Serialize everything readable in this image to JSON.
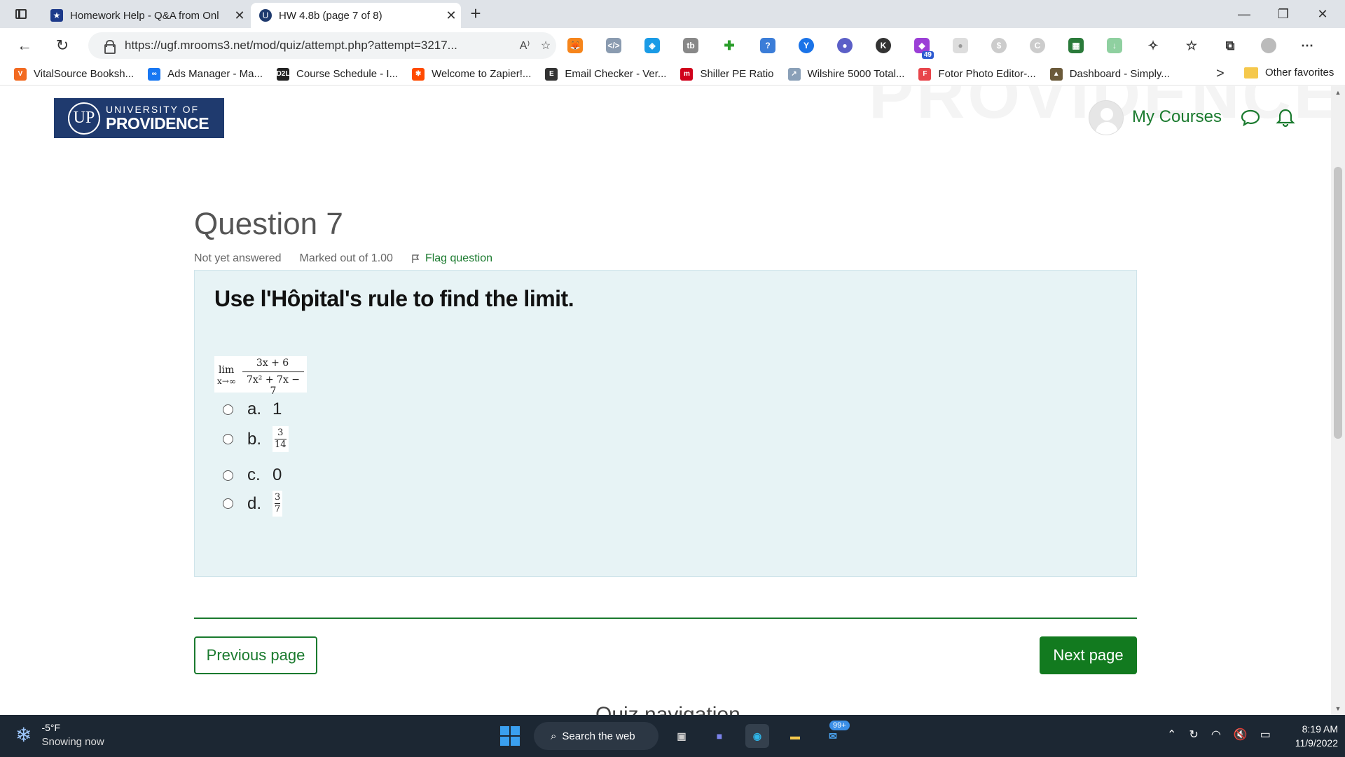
{
  "browser": {
    "tabs": [
      {
        "title": "Homework Help - Q&A from Onl",
        "favicon": "star-icon",
        "active": false
      },
      {
        "title": "HW 4.8b (page 7 of 8)",
        "favicon": "providence-icon",
        "active": true
      }
    ],
    "new_tab_glyph": "+",
    "url": "https://ugf.mrooms3.net/mod/quiz/attempt.php?attempt=3217...",
    "read_aloud_glyph": "A⁾",
    "extensions_badge": "49",
    "bookmarks": [
      {
        "label": "VitalSource Booksh...",
        "icon": "vitalsource-icon",
        "color": "#f26a21",
        "glyph": "V"
      },
      {
        "label": "Ads Manager - Ma...",
        "icon": "meta-icon",
        "color": "#1877f2",
        "glyph": "∞"
      },
      {
        "label": "Course Schedule - I...",
        "icon": "d2l-icon",
        "color": "#222222",
        "glyph": "D2L"
      },
      {
        "label": "Welcome to Zapier!...",
        "icon": "zapier-icon",
        "color": "#ff4a00",
        "glyph": "✱"
      },
      {
        "label": "Email Checker - Ver...",
        "icon": "email-checker-icon",
        "color": "#333333",
        "glyph": "E"
      },
      {
        "label": "Shiller PE Ratio",
        "icon": "multpl-icon",
        "color": "#d0021b",
        "glyph": "m"
      },
      {
        "label": "Wilshire 5000 Total...",
        "icon": "chart-icon",
        "color": "#8aa0b8",
        "glyph": "↗"
      },
      {
        "label": "Fotor Photo Editor-...",
        "icon": "fotor-icon",
        "color": "#e8454b",
        "glyph": "F"
      },
      {
        "label": "Dashboard - Simply...",
        "icon": "owl-icon",
        "color": "#6b5a3a",
        "glyph": "▲"
      }
    ],
    "more_glyph": ">",
    "other_favorites": "Other favorites"
  },
  "site": {
    "logo_line1": "UNIVERSITY OF",
    "logo_line2": "PROVIDENCE",
    "logo_seal": "UP",
    "watermark": "PROVIDENCE",
    "my_courses": "My Courses"
  },
  "question": {
    "title": "Question 7",
    "status": "Not yet answered",
    "marks": "Marked out of 1.00",
    "flag_label": "Flag question",
    "prompt": "Use l'Hôpital's rule to find the limit.",
    "formula": {
      "lim": "lim",
      "subscript": "x→∞",
      "numerator": "3x + 6",
      "denominator": "7x² + 7x − 7"
    },
    "options": [
      {
        "letter": "a.",
        "value": "1",
        "fraction": null
      },
      {
        "letter": "b.",
        "value": "",
        "fraction": {
          "num": "3",
          "den": "14"
        }
      },
      {
        "letter": "c.",
        "value": "0",
        "fraction": null
      },
      {
        "letter": "d.",
        "value": "",
        "fraction": {
          "num": "3",
          "den": "7"
        }
      }
    ]
  },
  "nav": {
    "previous": "Previous page",
    "next": "Next page",
    "quiz_navigation_peek": "Quiz navigation"
  },
  "taskbar": {
    "temperature": "-5°F",
    "weather": "Snowing now",
    "search": "Search the web",
    "mail_badge": "99+",
    "time": "8:19 AM",
    "date": "11/9/2022"
  },
  "colors": {
    "accent_green": "#1a7a2e",
    "question_bg": "#e7f3f5",
    "logo_blue": "#1f3a6e"
  }
}
